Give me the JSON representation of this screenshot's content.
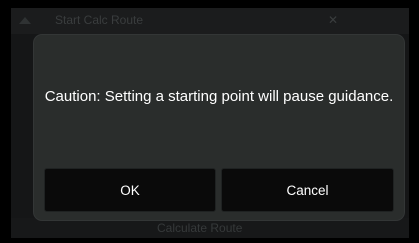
{
  "background": {
    "header_title": "Start Calc Route",
    "footer_label": "Calculate Route"
  },
  "dialog": {
    "message": "Caution: Setting a starting point will pause guidance.",
    "ok_label": "OK",
    "cancel_label": "Cancel"
  },
  "colors": {
    "dialog_bg": "#2a2d2c",
    "button_bg": "#0a0a0a",
    "text": "#ffffff"
  },
  "icons": [
    "back-arrow-icon",
    "close-icon"
  ]
}
